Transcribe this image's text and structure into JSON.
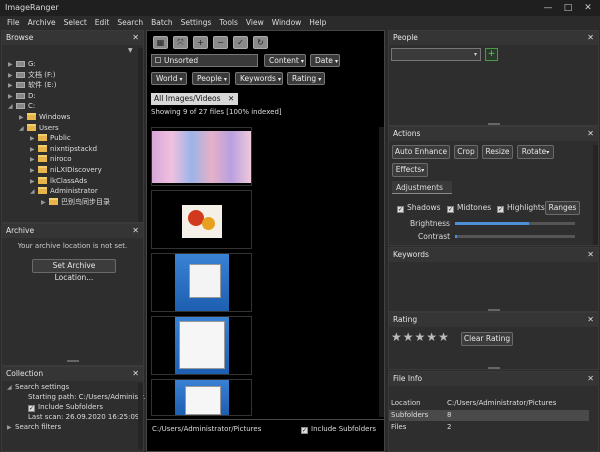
{
  "app": {
    "title": "ImageRanger",
    "win": {
      "minimize": "—",
      "maximize": "□",
      "close": "✕"
    }
  },
  "menu": [
    "File",
    "Archive",
    "Select",
    "Edit",
    "Search",
    "Batch",
    "Settings",
    "Tools",
    "View",
    "Window",
    "Help"
  ],
  "browse": {
    "title": "Browse",
    "close": "✕",
    "tree": [
      {
        "label": "G:",
        "kind": "drive",
        "expanded": false
      },
      {
        "label": "文档 (F:)",
        "kind": "drive",
        "expanded": false
      },
      {
        "label": "软件 (E:)",
        "kind": "drive",
        "expanded": false
      },
      {
        "label": "D:",
        "kind": "drive",
        "expanded": false
      },
      {
        "label": "C:",
        "kind": "drive",
        "expanded": true
      },
      {
        "label": "Windows",
        "kind": "folder",
        "expanded": false
      },
      {
        "label": "Users",
        "kind": "folder",
        "expanded": true
      },
      {
        "label": "Public",
        "kind": "folder",
        "expanded": false
      },
      {
        "label": "nixntipstackd",
        "kind": "folder",
        "expanded": false
      },
      {
        "label": "niroco",
        "kind": "folder",
        "expanded": false
      },
      {
        "label": "niLXIDiscovery",
        "kind": "folder",
        "expanded": false
      },
      {
        "label": "lkClassAds",
        "kind": "folder",
        "expanded": false
      },
      {
        "label": "Administrator",
        "kind": "folder",
        "expanded": true
      },
      {
        "label": "巴别鸟同步目录",
        "kind": "folder",
        "expanded": false
      }
    ]
  },
  "archive": {
    "title": "Archive",
    "close": "✕",
    "message": "Your archive location is not set.",
    "button": "Set Archive Location..."
  },
  "collection": {
    "title": "Collection",
    "close": "✕",
    "search_settings": "Search settings",
    "starting_path": "Starting path: C:/Users/Administr...",
    "include_subfolders": "Include Subfolders",
    "last_scan": "Last scan: 26.09.2020 16:25:09",
    "search_filters": "Search filters"
  },
  "center": {
    "filter_value": "Unsorted",
    "dropdowns": [
      "Content",
      "Date",
      "World",
      "People",
      "Keywords",
      "Rating"
    ],
    "tab_label": "All Images/Videos",
    "tab_close": "✕",
    "status": "Showing 9 of 27 files [100% indexed]",
    "path": "C:/Users/Administrator/Pictures",
    "include_subfolders": "Include Subfolders",
    "toolbar_icons": [
      "grid-icon",
      "fit-icon",
      "zoom-in-icon",
      "zoom-out-icon",
      "check-icon",
      "refresh-icon"
    ]
  },
  "people": {
    "title": "People",
    "close": "✕",
    "select_value": "",
    "add": "+"
  },
  "actions": {
    "title": "Actions",
    "close": "✕",
    "buttons": [
      "Auto Enhance",
      "Crop",
      "Resize",
      "Rotate"
    ],
    "effects": "Effects",
    "adjust_tab": "Adjustments",
    "shadows": "Shadows",
    "midtones": "Midtones",
    "highlights": "Highlights",
    "ranges": "Ranges",
    "brightness": "Brightness",
    "contrast": "Contrast",
    "brightness_value": 0.62,
    "contrast_value": 0.02
  },
  "keywords": {
    "title": "Keywords",
    "close": "✕"
  },
  "rating": {
    "title": "Rating",
    "close": "✕",
    "stars": "★",
    "clear": "Clear Rating",
    "value": 5
  },
  "fileinfo": {
    "title": "File Info",
    "close": "✕",
    "rows": [
      [
        "Location",
        "C:/Users/Administrator/Pictures"
      ],
      [
        "Subfolders",
        "8"
      ],
      [
        "Files",
        "2"
      ]
    ]
  }
}
